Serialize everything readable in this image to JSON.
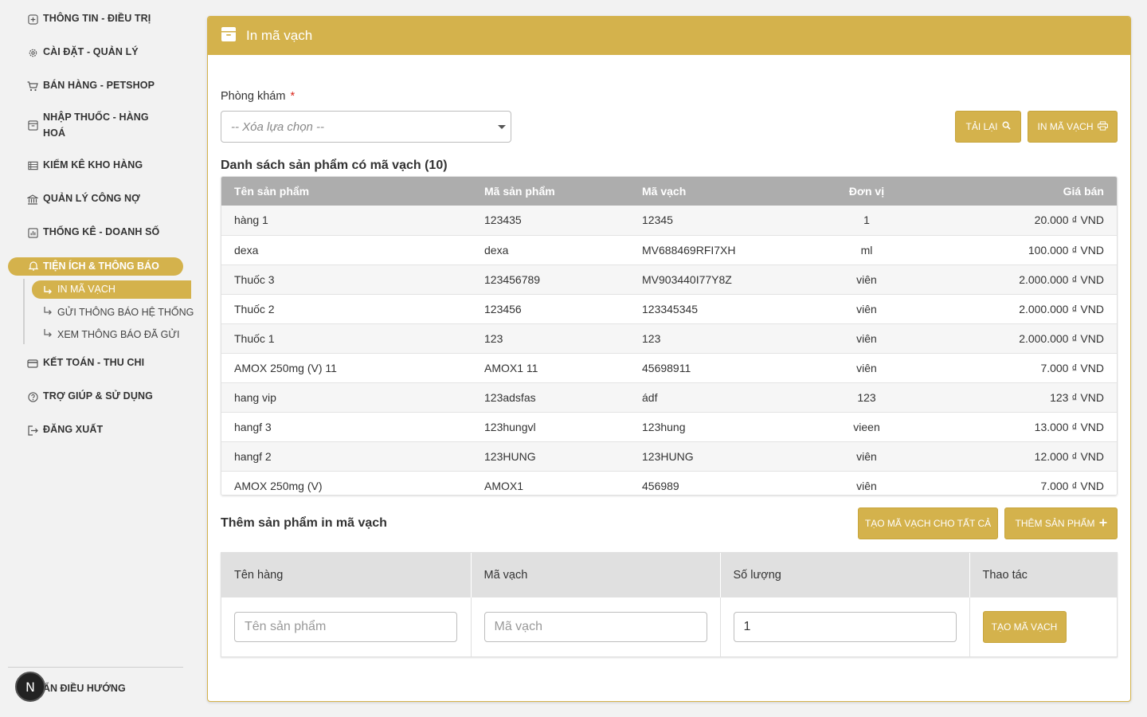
{
  "sidebar": {
    "items": [
      {
        "label": "THÔNG TIN - ĐIỀU TRỊ",
        "icon": "medical-icon"
      },
      {
        "label": "CÀI ĐẶT - QUẢN LÝ",
        "icon": "gear-icon"
      },
      {
        "label": "BÁN HÀNG - PETSHOP",
        "icon": "cart-icon"
      },
      {
        "label": "NHẬP THUỐC - HÀNG",
        "label2": "HOÁ",
        "icon": "archive-icon"
      },
      {
        "label": "KIỂM KÊ KHO HÀNG",
        "icon": "list-icon"
      },
      {
        "label": "QUẢN LÝ CÔNG NỢ",
        "icon": "bank-icon"
      },
      {
        "label": "THỐNG KÊ - DOANH SỐ",
        "icon": "chart-icon"
      },
      {
        "label": "TIỆN ÍCH & THÔNG BÁO",
        "icon": "bell-icon"
      },
      {
        "label": "KẾT TOÁN - THU CHI",
        "icon": "card-icon"
      },
      {
        "label": "TRỢ GIÚP & SỬ DỤNG",
        "icon": "help-icon"
      },
      {
        "label": "ĐĂNG XUẤT",
        "icon": "logout-icon"
      }
    ],
    "sub_items": [
      {
        "label": "IN MÃ VẠCH"
      },
      {
        "label": "GỬI THÔNG BÁO HỆ THỐNG"
      },
      {
        "label": "XEM THÔNG BÁO ĐÃ GỬI"
      }
    ],
    "collapse_label": "ẨN ĐIỀU HƯỚNG",
    "badge": "N",
    "accent": "#d4b24c"
  },
  "panel": {
    "title": "In mã vạch",
    "clinic_label": "Phòng khám",
    "required_mark": "*",
    "clinic_placeholder": "-- Xóa lựa chọn --",
    "reload_button": "TẢI LẠI",
    "print_button": "IN MÃ VẠCH",
    "list_title": "Danh sách sản phẩm có mã vạch (10)",
    "columns": [
      "Tên sản phẩm",
      "Mã sản phẩm",
      "Mã vạch",
      "Đơn vị",
      "Giá bán"
    ],
    "rows": [
      [
        "hàng 1",
        "123435",
        "12345",
        "1",
        "20.000 ₫ VND"
      ],
      [
        "dexa",
        "dexa",
        "MV688469RFI7XH",
        "ml",
        "100.000 ₫ VND"
      ],
      [
        "Thuốc 3",
        "123456789",
        "MV903440I77Y8Z",
        "viên",
        "2.000.000 ₫ VND"
      ],
      [
        "Thuốc 2",
        "123456",
        "123345345",
        "viên",
        "2.000.000 ₫ VND"
      ],
      [
        "Thuốc 1",
        "123",
        "123",
        "viên",
        "2.000.000 ₫ VND"
      ],
      [
        "AMOX 250mg (V) 11",
        "AMOX1 11",
        "45698911",
        "viên",
        "7.000 ₫ VND"
      ],
      [
        "hang vip",
        "123adsfas",
        "ádf",
        "123",
        "123 ₫ VND"
      ],
      [
        "hangf 3",
        "123hungvl",
        "123hung",
        "vieen",
        "13.000 ₫ VND"
      ],
      [
        "hangf 2",
        "123HUNG",
        "123HUNG",
        "viên",
        "12.000 ₫ VND"
      ],
      [
        "AMOX 250mg (V)",
        "AMOX1",
        "456989",
        "viên",
        "7.000 ₫ VND"
      ]
    ],
    "add_title": "Thêm sản phẩm in mã vạch",
    "gen_all_button": "TẠO MÃ VẠCH CHO TẤT CẢ",
    "add_product_button": "THÊM SẢN PHẨM",
    "add_columns": [
      "Tên hàng",
      "Mã vạch",
      "Số lượng",
      "Thao tác"
    ],
    "add_row": {
      "name_placeholder": "Tên sản phẩm",
      "barcode_placeholder": "Mã vạch",
      "quantity": "1",
      "action_button": "TẠO MÃ VẠCH"
    }
  }
}
